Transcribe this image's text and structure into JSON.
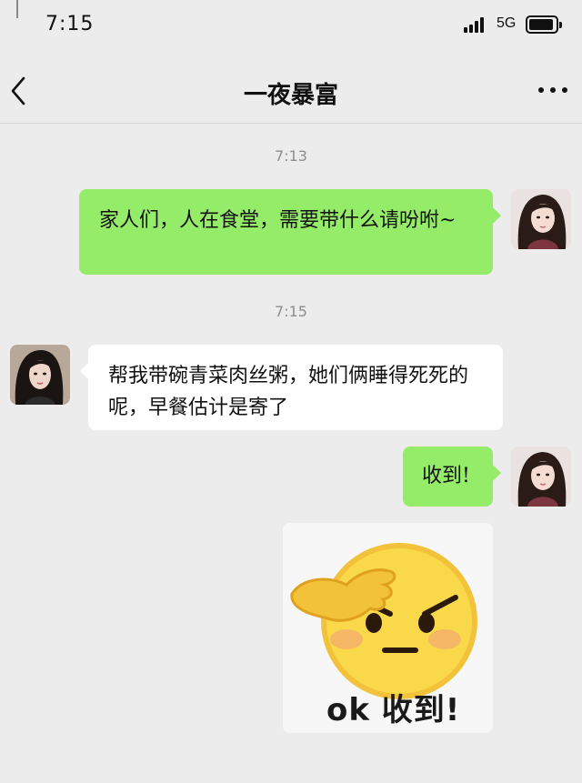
{
  "status_bar": {
    "time": "7:15",
    "network": "5G"
  },
  "header": {
    "title": "一夜暴富"
  },
  "messages": [
    {
      "type": "timestamp",
      "text": "7:13"
    },
    {
      "type": "text",
      "side": "right",
      "text": "家人们，人在食堂，需要带什么请吩咐~"
    },
    {
      "type": "timestamp",
      "text": "7:15"
    },
    {
      "type": "text",
      "side": "left",
      "text": "帮我带碗青菜肉丝粥，她们俩睡得死死的呢，早餐估计是寄了"
    },
    {
      "type": "text",
      "side": "right",
      "text": "收到!"
    },
    {
      "type": "sticker",
      "side": "right",
      "text": "ok 收到!"
    }
  ],
  "colors": {
    "sent_bubble": "#95ec69",
    "received_bubble": "#ffffff",
    "background": "#ececec"
  }
}
